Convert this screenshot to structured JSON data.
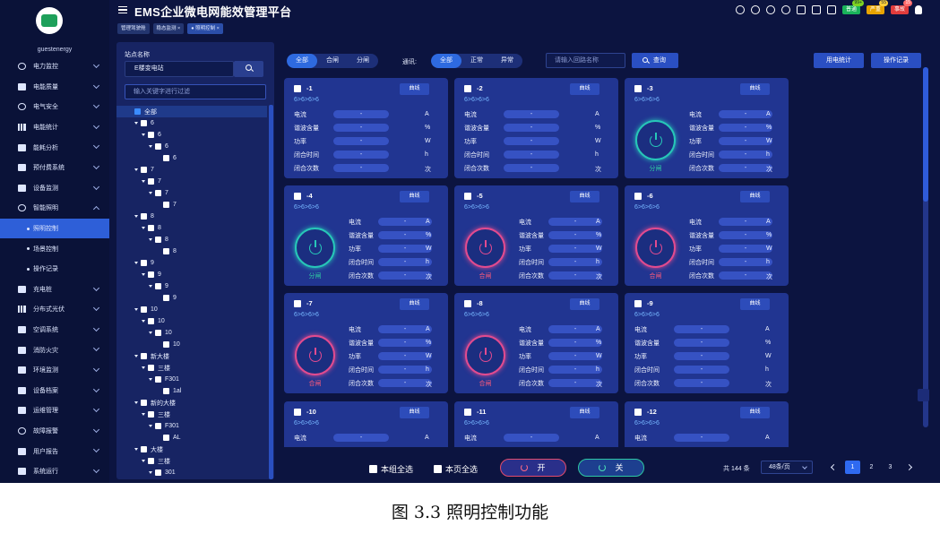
{
  "header": {
    "title": "EMS企业微电网能效管理平台",
    "badges": [
      {
        "label": "普通",
        "count": "99+"
      },
      {
        "label": "严重",
        "count": "55"
      },
      {
        "label": "事故",
        "count": "15"
      }
    ]
  },
  "sidebar": {
    "user": "guestenergy",
    "items": [
      {
        "label": "电力监控"
      },
      {
        "label": "电能质量"
      },
      {
        "label": "电气安全"
      },
      {
        "label": "电能统计"
      },
      {
        "label": "能耗分析"
      },
      {
        "label": "预付费系统"
      },
      {
        "label": "设备监测"
      },
      {
        "label": "智能照明"
      },
      {
        "label": "照明控制"
      },
      {
        "label": "场景控制"
      },
      {
        "label": "操作记录"
      },
      {
        "label": "充电桩"
      },
      {
        "label": "分布式光伏"
      },
      {
        "label": "空调系统"
      },
      {
        "label": "消防火灾"
      },
      {
        "label": "环境监测"
      },
      {
        "label": "设备档案"
      },
      {
        "label": "运维管理"
      },
      {
        "label": "故障报警"
      },
      {
        "label": "用户报告"
      },
      {
        "label": "系统运行"
      }
    ]
  },
  "breadcrumbs": [
    {
      "label": "管理驾驶舱"
    },
    {
      "label": "稳态监测 ×"
    },
    {
      "label": "● 照明控制 ×"
    }
  ],
  "station": {
    "label": "站点名称",
    "value": "E楼变电站",
    "filter_placeholder": "输入关键字进行过滤"
  },
  "tree": [
    {
      "label": "全部"
    },
    {
      "label": "6"
    },
    {
      "label": "6"
    },
    {
      "label": "6"
    },
    {
      "label": "6"
    },
    {
      "label": "7"
    },
    {
      "label": "7"
    },
    {
      "label": "7"
    },
    {
      "label": "7"
    },
    {
      "label": "8"
    },
    {
      "label": "8"
    },
    {
      "label": "8"
    },
    {
      "label": "8"
    },
    {
      "label": "9"
    },
    {
      "label": "9"
    },
    {
      "label": "9"
    },
    {
      "label": "9"
    },
    {
      "label": "10"
    },
    {
      "label": "10"
    },
    {
      "label": "10"
    },
    {
      "label": "10"
    },
    {
      "label": "新大楼"
    },
    {
      "label": "三楼"
    },
    {
      "label": "F301"
    },
    {
      "label": "1al"
    },
    {
      "label": "新的大楼"
    },
    {
      "label": "三楼"
    },
    {
      "label": "F301"
    },
    {
      "label": "AL"
    },
    {
      "label": "大楼"
    },
    {
      "label": "三楼"
    },
    {
      "label": "301"
    }
  ],
  "toolbar": {
    "mode_tabs": [
      {
        "label": "全部"
      },
      {
        "label": "合闸"
      },
      {
        "label": "分闸"
      }
    ],
    "comm_label": "通讯:",
    "comm_tabs": [
      {
        "label": "全部"
      },
      {
        "label": "正常"
      },
      {
        "label": "异常"
      }
    ],
    "loop_placeholder": "请输入回路名称",
    "query_label": "查询",
    "stats_label": "用电统计",
    "log_label": "操作记录"
  },
  "card_common": {
    "curve_label": "曲线",
    "path": "6>6>6>6",
    "metric_names": [
      "电流",
      "谐波含量",
      "功率",
      "闭合时间",
      "闭合次数"
    ],
    "metric_units": [
      "A",
      "%",
      "W",
      "h",
      "次"
    ],
    "metric_value": "-"
  },
  "cards": [
    {
      "name": "-1",
      "state": ""
    },
    {
      "name": "-2",
      "state": ""
    },
    {
      "name": "-3",
      "state": "分闸"
    },
    {
      "name": "-4",
      "state": "分闸"
    },
    {
      "name": "-5",
      "state": "合闸"
    },
    {
      "name": "-6",
      "state": "合闸"
    },
    {
      "name": "-7",
      "state": "合闸"
    },
    {
      "name": "-8",
      "state": "合闸"
    },
    {
      "name": "-9",
      "state": ""
    },
    {
      "name": "-10",
      "state": ""
    },
    {
      "name": "-11",
      "state": ""
    },
    {
      "name": "-12",
      "state": ""
    }
  ],
  "bottom": {
    "group_all": "本组全选",
    "page_all": "本页全选",
    "on_label": "开",
    "off_label": "关",
    "total": "共 144 条",
    "per_page": "48条/页",
    "pages": [
      "1",
      "2",
      "3"
    ]
  },
  "caption": "图 3.3 照明控制功能",
  "colors": {
    "background": "#0c1440",
    "card": "#213591",
    "accent": "#2e6ae0",
    "on_state": "#27c7b8",
    "off_state": "#e24b8f"
  }
}
